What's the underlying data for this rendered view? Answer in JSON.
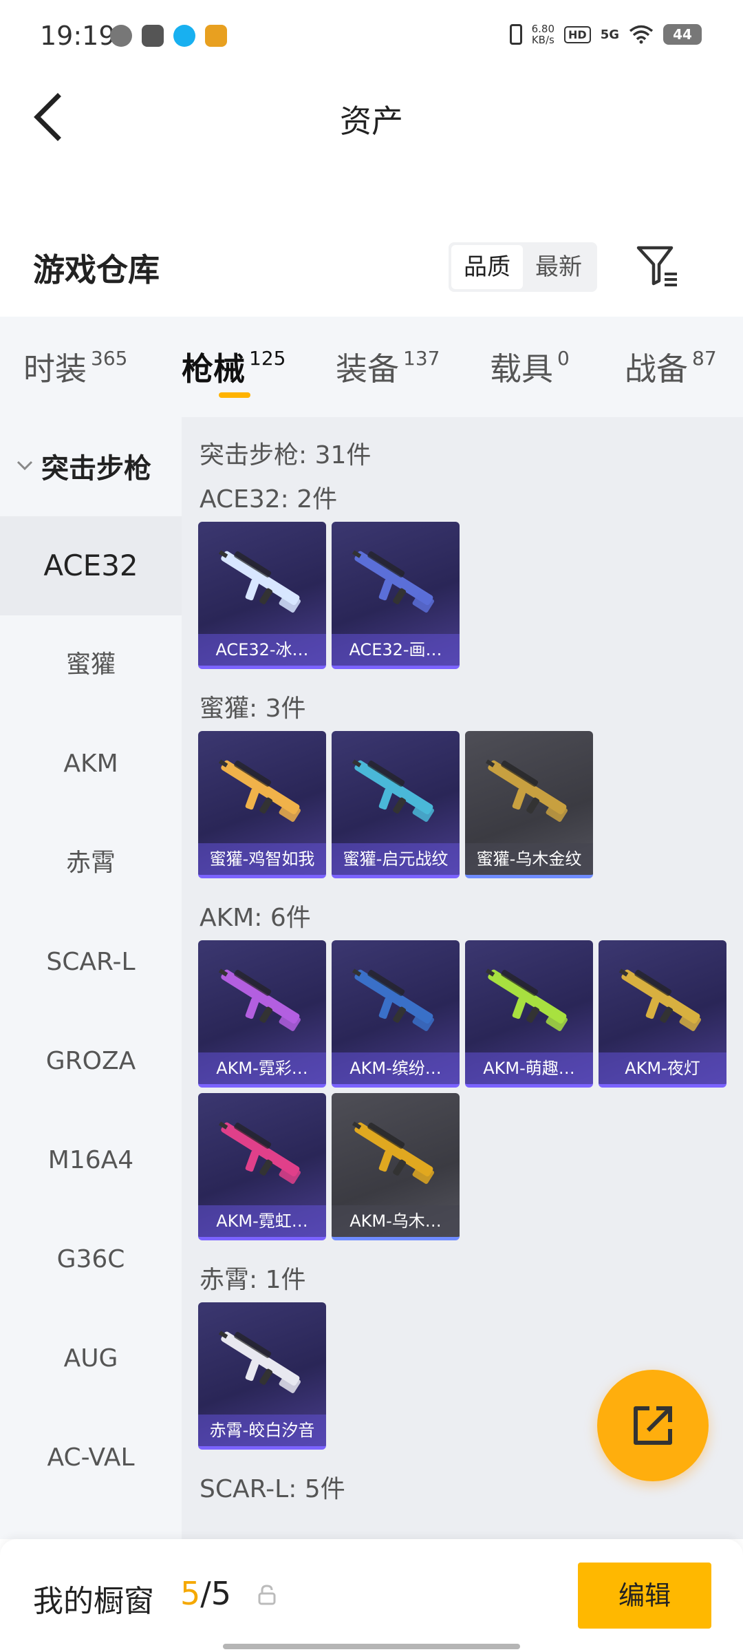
{
  "status_bar": {
    "time": "19:19",
    "net_speed": "6.80",
    "net_unit": "KB/s",
    "hd": "HD",
    "network": "5G",
    "battery": "44"
  },
  "header": {
    "title": "资产"
  },
  "warehouse": {
    "title": "游戏仓库",
    "sort_options": [
      "品质",
      "最新"
    ],
    "active_sort": "品质"
  },
  "tabs": [
    {
      "label": "时装",
      "count": "365"
    },
    {
      "label": "枪械",
      "count": "125"
    },
    {
      "label": "装备",
      "count": "137"
    },
    {
      "label": "载具",
      "count": "0"
    },
    {
      "label": "战备",
      "count": "87"
    }
  ],
  "active_tab": "枪械",
  "sidebar": {
    "category": "突击步枪",
    "items": [
      "ACE32",
      "蜜獾",
      "AKM",
      "赤霄",
      "SCAR-L",
      "GROZA",
      "M16A4",
      "G36C",
      "AUG",
      "AC-VAL"
    ],
    "active_item": "ACE32"
  },
  "content": {
    "summary": "突击步枪: 31件",
    "groups": [
      {
        "title": "ACE32: 2件",
        "items": [
          {
            "label": "ACE32-冰…",
            "tone": "purple",
            "accent": "#d8e6ff"
          },
          {
            "label": "ACE32-画…",
            "tone": "purple",
            "accent": "#5b6fd8"
          }
        ]
      },
      {
        "title": "蜜獾: 3件",
        "items": [
          {
            "label": "蜜獾-鸡智如我",
            "tone": "purple",
            "accent": "#f0b24a"
          },
          {
            "label": "蜜獾-启元战纹",
            "tone": "purple",
            "accent": "#4ab8d8"
          },
          {
            "label": "蜜獾-乌木金纹",
            "tone": "grey",
            "accent": "#c8a040"
          }
        ]
      },
      {
        "title": "AKM: 6件",
        "items": [
          {
            "label": "AKM-霓彩…",
            "tone": "purple",
            "accent": "#b35fe0"
          },
          {
            "label": "AKM-缤纷…",
            "tone": "purple",
            "accent": "#3a70c8"
          },
          {
            "label": "AKM-萌趣…",
            "tone": "purple",
            "accent": "#a8e040"
          },
          {
            "label": "AKM-夜灯",
            "tone": "purple",
            "accent": "#d8b040"
          },
          {
            "label": "AKM-霓虹…",
            "tone": "purple",
            "accent": "#e0408a"
          },
          {
            "label": "AKM-乌木…",
            "tone": "grey",
            "accent": "#e0a820"
          }
        ]
      },
      {
        "title": "赤霄: 1件",
        "items": [
          {
            "label": "赤霄-皎白汐音",
            "tone": "purple",
            "accent": "#e8e8f0"
          }
        ]
      },
      {
        "title": "SCAR-L: 5件",
        "items": []
      }
    ]
  },
  "bottom_bar": {
    "label": "我的橱窗",
    "count_current": "5",
    "count_sep": "/",
    "count_total": "5",
    "edit_label": "编辑"
  },
  "colors": {
    "accent": "#ffb300",
    "card_border": "#7b63ff"
  },
  "icons": [
    "back-icon",
    "filter-icon",
    "chevron-down-icon",
    "share-icon",
    "lock-icon"
  ]
}
